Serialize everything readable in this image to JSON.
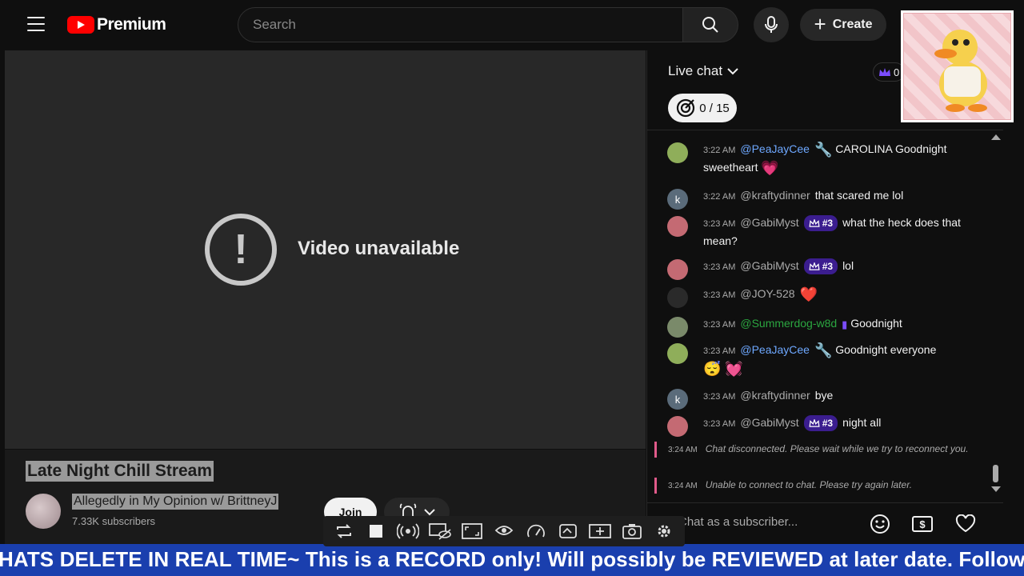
{
  "header": {
    "logo_text": "Premium",
    "search_placeholder": "Search",
    "create_label": "Create"
  },
  "player": {
    "unavailable_text": "Video unavailable"
  },
  "video": {
    "title": "Late Night Chill Stream",
    "channel": "Allegedly in My Opinion w/ BrittneyJ",
    "subscribers": "7.33K subscribers",
    "join_label": "Join"
  },
  "chat": {
    "title": "Live chat",
    "crown_count": "0",
    "goal": "0 / 15",
    "messages": [
      {
        "time": "3:22 AM",
        "author": "@PeaJayCee",
        "text": "CAROLINA Goodnight sweetheart",
        "emoji": "💗"
      },
      {
        "time": "3:22 AM",
        "author": "@kraftydinner",
        "text": "that scared me lol",
        "avatar_letter": "k"
      },
      {
        "time": "3:23 AM",
        "author": "@GabiMyst",
        "badge": "#3",
        "text": "what the heck does that mean?"
      },
      {
        "time": "3:23 AM",
        "author": "@GabiMyst",
        "badge": "#3",
        "text": "lol"
      },
      {
        "time": "3:23 AM",
        "author": "@JOY-528",
        "emoji": "❤️"
      },
      {
        "time": "3:23 AM",
        "author": "@Summerdog-w8d",
        "text": "Goodnight"
      },
      {
        "time": "3:23 AM",
        "author": "@PeaJayCee",
        "text": "Goodnight everyone",
        "emoji": "😴 💓"
      },
      {
        "time": "3:23 AM",
        "author": "@kraftydinner",
        "text": "bye",
        "avatar_letter": "k"
      },
      {
        "time": "3:23 AM",
        "author": "@GabiMyst",
        "badge": "#3",
        "text": "night all"
      }
    ],
    "system": [
      {
        "time": "3:24 AM",
        "text": "Chat disconnected. Please wait while we try to reconnect you."
      },
      {
        "time": "3:24 AM",
        "text": "Unable to connect to chat. Please try again later."
      }
    ],
    "input_placeholder": "Chat as a subscriber..."
  },
  "ticker": {
    "text": "HATS DELETE IN REAL TIME~ This is a RECORD only! Will possibly be REVIEWED at later date. Follow me o"
  },
  "colors": {
    "accent_red": "#ff0000",
    "ticker_bg": "#1a3fae",
    "member_badge": "#3b1d8f",
    "author_blue": "#6ea8ff",
    "author_green": "#2ba640"
  }
}
